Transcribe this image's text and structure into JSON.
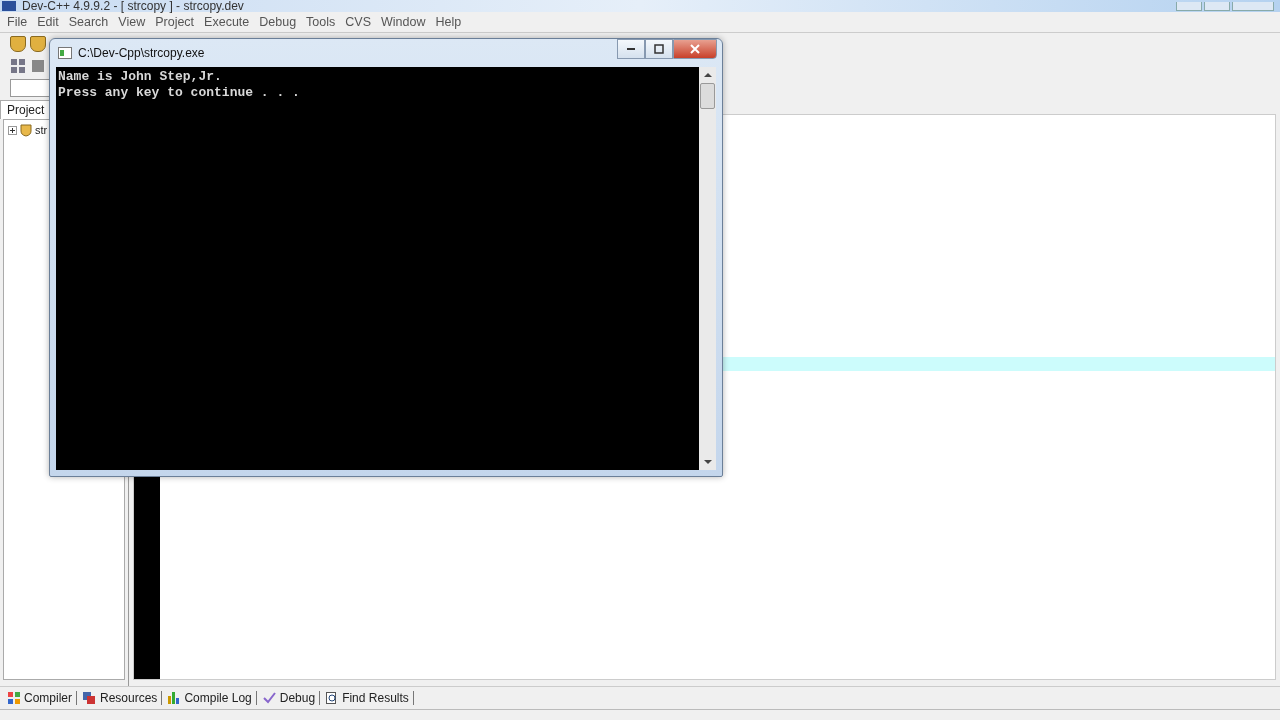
{
  "window": {
    "title": "Dev-C++ 4.9.9.2  - [ strcopy ] - strcopy.dev"
  },
  "menu": [
    "File",
    "Edit",
    "Search",
    "View",
    "Project",
    "Execute",
    "Debug",
    "Tools",
    "CVS",
    "Window",
    "Help"
  ],
  "project_panel": {
    "tab": "Project",
    "tree": [
      {
        "label": "str",
        "expanded": false
      }
    ]
  },
  "bottom_tabs": [
    {
      "label": "Compiler",
      "kind": "grid"
    },
    {
      "label": "Resources",
      "kind": "resources"
    },
    {
      "label": "Compile Log",
      "kind": "chart"
    },
    {
      "label": "Debug",
      "kind": "check"
    },
    {
      "label": "Find Results",
      "kind": "find"
    }
  ],
  "console": {
    "title": "C:\\Dev-Cpp\\strcopy.exe",
    "lines": [
      "Name is John Step,Jr.",
      "Press any key to continue . . ."
    ]
  }
}
